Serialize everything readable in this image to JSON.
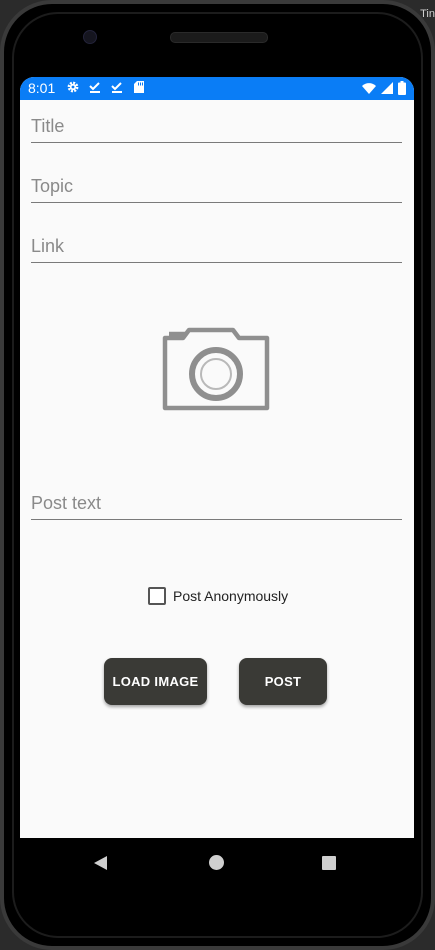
{
  "status_bar": {
    "time": "8:01",
    "icons_left": [
      "gear-icon",
      "download-done-icon",
      "download-done-icon",
      "sd-card-icon"
    ],
    "icons_right": [
      "wifi-icon",
      "signal-icon",
      "battery-icon"
    ],
    "color": "#0a7df6"
  },
  "corner_label": "Tin",
  "form": {
    "title_placeholder": "Title",
    "topic_placeholder": "Topic",
    "link_placeholder": "Link",
    "post_text_placeholder": "Post text",
    "image_icon": "camera-icon",
    "anonymous_label": "Post Anonymously",
    "anonymous_checked": false
  },
  "buttons": {
    "load_image": "LOAD IMAGE",
    "post": "POST",
    "color": "#3a3a36"
  },
  "nav_bar": {
    "icons": [
      "back-icon",
      "home-icon",
      "recents-icon"
    ]
  }
}
